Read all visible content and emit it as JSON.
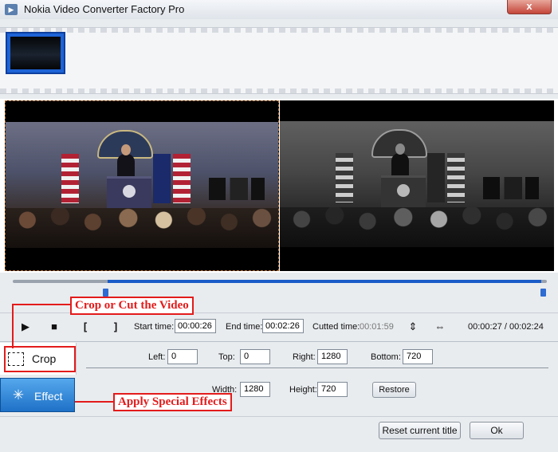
{
  "window": {
    "title": "Nokia Video Converter Factory Pro",
    "close_label": "x"
  },
  "controls": {
    "start_time_label": "Start time:",
    "start_time_value": "00:00:26",
    "end_time_label": "End time:",
    "end_time_value": "00:02:26",
    "cutted_time_label": "Cutted time:",
    "cutted_time_value": "00:01:59",
    "time_display": "00:00:27 / 00:02:24"
  },
  "tabs": {
    "crop_label": "Crop",
    "effect_label": "Effect"
  },
  "crop": {
    "left_label": "Left:",
    "left_value": "0",
    "top_label": "Top:",
    "top_value": "0",
    "right_label": "Right:",
    "right_value": "1280",
    "bottom_label": "Bottom:",
    "bottom_value": "720",
    "width_label": "Width:",
    "width_value": "1280",
    "height_label": "Height:",
    "height_value": "720",
    "restore_label": "Restore"
  },
  "footer": {
    "reset_label": "Reset current title",
    "ok_label": "Ok"
  },
  "annotations": {
    "crop_callout": "Crop or Cut the Video",
    "effect_callout": "Apply Special Effects"
  },
  "icons": [
    "app-icon",
    "play-icon",
    "stop-icon",
    "mark-in-icon",
    "mark-out-icon",
    "flip-vertical-icon",
    "flip-horizontal-icon",
    "crop-icon",
    "effect-icon"
  ],
  "colors": {
    "accent": "#1a5cc8",
    "annotation": "#e31b1b",
    "effect_tab": "#1e71c7"
  }
}
